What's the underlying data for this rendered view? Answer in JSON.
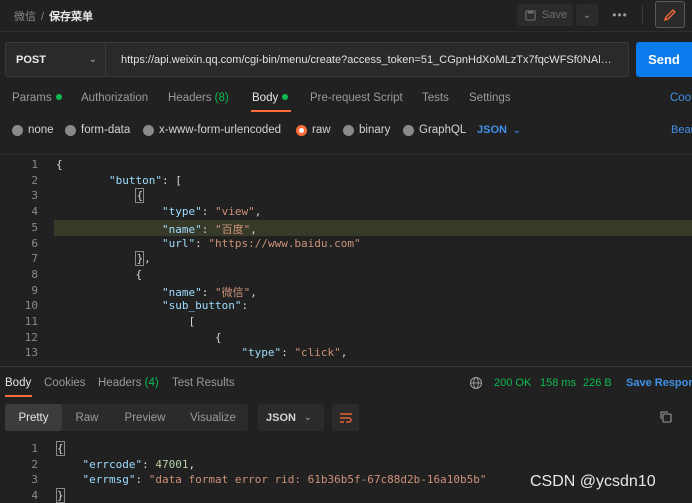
{
  "breadcrumb": {
    "parent": "微信",
    "separator": "/",
    "current": "保存菜单"
  },
  "toolbar": {
    "save_label": "Save"
  },
  "request": {
    "method": "POST",
    "url": "https://api.weixin.qq.com/cgi-bin/menu/create?access_token=51_CGpnHdXoMLzTx7fqcWFSf0NAl…",
    "send_label": "Send"
  },
  "request_tabs": {
    "params": "Params",
    "authorization": "Authorization",
    "headers": "Headers",
    "headers_count": "(8)",
    "body": "Body",
    "pre_request": "Pre-request Script",
    "tests": "Tests",
    "settings": "Settings",
    "cookies": "Coo"
  },
  "body_types": {
    "none": "none",
    "form_data": "form-data",
    "urlencoded": "x-www-form-urlencoded",
    "raw": "raw",
    "binary": "binary",
    "graphql": "GraphQL",
    "format": "JSON",
    "beautify": "Beau"
  },
  "editor": {
    "line_numbers": [
      "1",
      "2",
      "3",
      "4",
      "5",
      "6",
      "7",
      "8",
      "9",
      "10",
      "11",
      "12",
      "13"
    ],
    "lines": [
      {
        "indent": "",
        "parts": [
          [
            "p",
            "{"
          ]
        ]
      },
      {
        "indent": "        ",
        "parts": [
          [
            "k",
            "\"button\""
          ],
          [
            "p",
            ": ["
          ]
        ]
      },
      {
        "indent": "            ",
        "parts": [
          [
            "b",
            "{"
          ]
        ]
      },
      {
        "indent": "                ",
        "parts": [
          [
            "k",
            "\"type\""
          ],
          [
            "p",
            ": "
          ],
          [
            "s",
            "\"view\""
          ],
          [
            "p",
            ","
          ]
        ]
      },
      {
        "indent": "                ",
        "parts": [
          [
            "k",
            "\"name\""
          ],
          [
            "p",
            ": "
          ],
          [
            "s",
            "\"百度\""
          ],
          [
            "p",
            ","
          ]
        ]
      },
      {
        "indent": "                ",
        "parts": [
          [
            "k",
            "\"url\""
          ],
          [
            "p",
            ": "
          ],
          [
            "s",
            "\"https://www.baidu.com\""
          ]
        ]
      },
      {
        "indent": "            ",
        "parts": [
          [
            "b",
            "}"
          ],
          [
            "p",
            ","
          ]
        ]
      },
      {
        "indent": "            ",
        "parts": [
          [
            "p",
            "{"
          ]
        ]
      },
      {
        "indent": "                ",
        "parts": [
          [
            "k",
            "\"name\""
          ],
          [
            "p",
            ": "
          ],
          [
            "s",
            "\"微信\""
          ],
          [
            "p",
            ","
          ]
        ]
      },
      {
        "indent": "                ",
        "parts": [
          [
            "k",
            "\"sub_button\""
          ],
          [
            "p",
            ":"
          ]
        ]
      },
      {
        "indent": "                    ",
        "parts": [
          [
            "p",
            "["
          ]
        ]
      },
      {
        "indent": "                        ",
        "parts": [
          [
            "p",
            "{"
          ]
        ]
      },
      {
        "indent": "                            ",
        "parts": [
          [
            "k",
            "\"type\""
          ],
          [
            "p",
            ": "
          ],
          [
            "s",
            "\"click\""
          ],
          [
            "p",
            ","
          ]
        ]
      }
    ]
  },
  "response_tabs": {
    "body": "Body",
    "cookies": "Cookies",
    "headers": "Headers",
    "headers_count": "(4)",
    "test_results": "Test Results"
  },
  "response_meta": {
    "status": "200 OK",
    "time": "158 ms",
    "size": "226 B",
    "save_response": "Save Respon"
  },
  "response_view": {
    "pretty": "Pretty",
    "raw": "Raw",
    "preview": "Preview",
    "visualize": "Visualize",
    "format": "JSON"
  },
  "response_body": {
    "line_numbers": [
      "1",
      "2",
      "3",
      "4"
    ],
    "lines": [
      {
        "indent": "",
        "parts": [
          [
            "b",
            "{"
          ]
        ]
      },
      {
        "indent": "    ",
        "parts": [
          [
            "k",
            "\"errcode\""
          ],
          [
            "p",
            ": "
          ],
          [
            "n",
            "47001"
          ],
          [
            "p",
            ","
          ]
        ]
      },
      {
        "indent": "    ",
        "parts": [
          [
            "k",
            "\"errmsg\""
          ],
          [
            "p",
            ": "
          ],
          [
            "s",
            "\"data format error rid: 61b36b5f-67c88d2b-16a10b5b\""
          ]
        ]
      },
      {
        "indent": "",
        "parts": [
          [
            "b",
            "}"
          ]
        ]
      }
    ]
  },
  "watermark": "CSDN @ycsdn10",
  "colors": {
    "accent": "#ff6c37",
    "send": "#097bed",
    "link": "#3f92e8",
    "ok": "#0cbb52"
  }
}
